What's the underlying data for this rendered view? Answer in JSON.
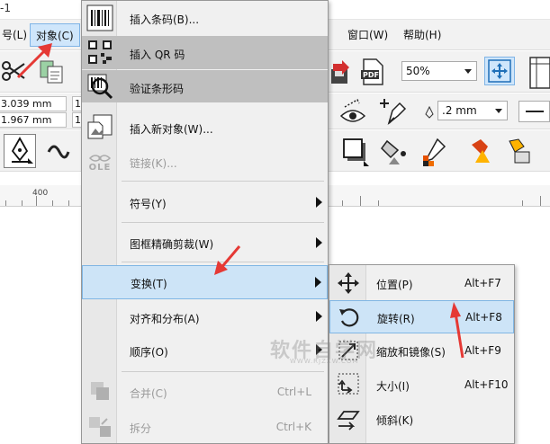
{
  "title": "-1",
  "menubar": {
    "items": [
      "号(L)",
      "对象(C)",
      "窗口(W)",
      "帮助(H)"
    ],
    "active": "对象(C)"
  },
  "toolbar": {
    "zoom_value": "50%",
    "coord_x": "3.039 mm",
    "coord_y": "1.967 mm",
    "outline_width": ".2 mm",
    "dim_1": "1",
    "dim_2": "1",
    "pdf_label": "PDF"
  },
  "ruler": {
    "label": "400"
  },
  "menu": {
    "items": [
      {
        "label": "插入条码(B)...",
        "icon": "barcode-icon",
        "highlight": false,
        "disabled": false
      },
      {
        "label": "插入 QR 码",
        "icon": "qr-code-icon",
        "highlight": true,
        "disabled": false
      },
      {
        "label": "验证条形码",
        "icon": "verify-barcode-icon",
        "highlight": true,
        "disabled": false
      },
      {
        "label": "插入新对象(W)...",
        "icon": "insert-object-icon",
        "highlight": false,
        "disabled": false
      },
      {
        "label": "链接(K)...",
        "icon": "ole-icon",
        "highlight": false,
        "disabled": true
      },
      {
        "label": "符号(Y)",
        "submenu": true
      },
      {
        "label": "图框精确剪裁(W)",
        "submenu": true
      },
      {
        "label": "变换(T)",
        "submenu": true,
        "selected": true
      },
      {
        "label": "对齐和分布(A)",
        "submenu": true
      },
      {
        "label": "顺序(O)",
        "submenu": true
      },
      {
        "label": "合并(C)",
        "shortcut": "Ctrl+L",
        "disabled": true,
        "icon": "combine-icon"
      },
      {
        "label": "拆分",
        "shortcut": "Ctrl+K",
        "disabled": true,
        "icon": "break-apart-icon"
      }
    ],
    "ole_text": "OLE"
  },
  "submenu": {
    "items": [
      {
        "label": "位置(P)",
        "shortcut": "Alt+F7",
        "icon": "move-icon"
      },
      {
        "label": "旋转(R)",
        "shortcut": "Alt+F8",
        "icon": "rotate-icon",
        "selected": true
      },
      {
        "label": "缩放和镜像(S)",
        "shortcut": "Alt+F9",
        "icon": "scale-mirror-icon"
      },
      {
        "label": "大小(I)",
        "shortcut": "Alt+F10",
        "icon": "size-icon"
      },
      {
        "label": "倾斜(K)",
        "shortcut": "",
        "icon": "skew-icon"
      }
    ]
  },
  "watermark": {
    "main": "软件自学网",
    "sub": "WWW.RJZXW.COM"
  },
  "colors": {
    "accent_arrow": "#e53935",
    "menu_highlight": "#bfbfbf",
    "menu_selected": "#cde4f7"
  }
}
